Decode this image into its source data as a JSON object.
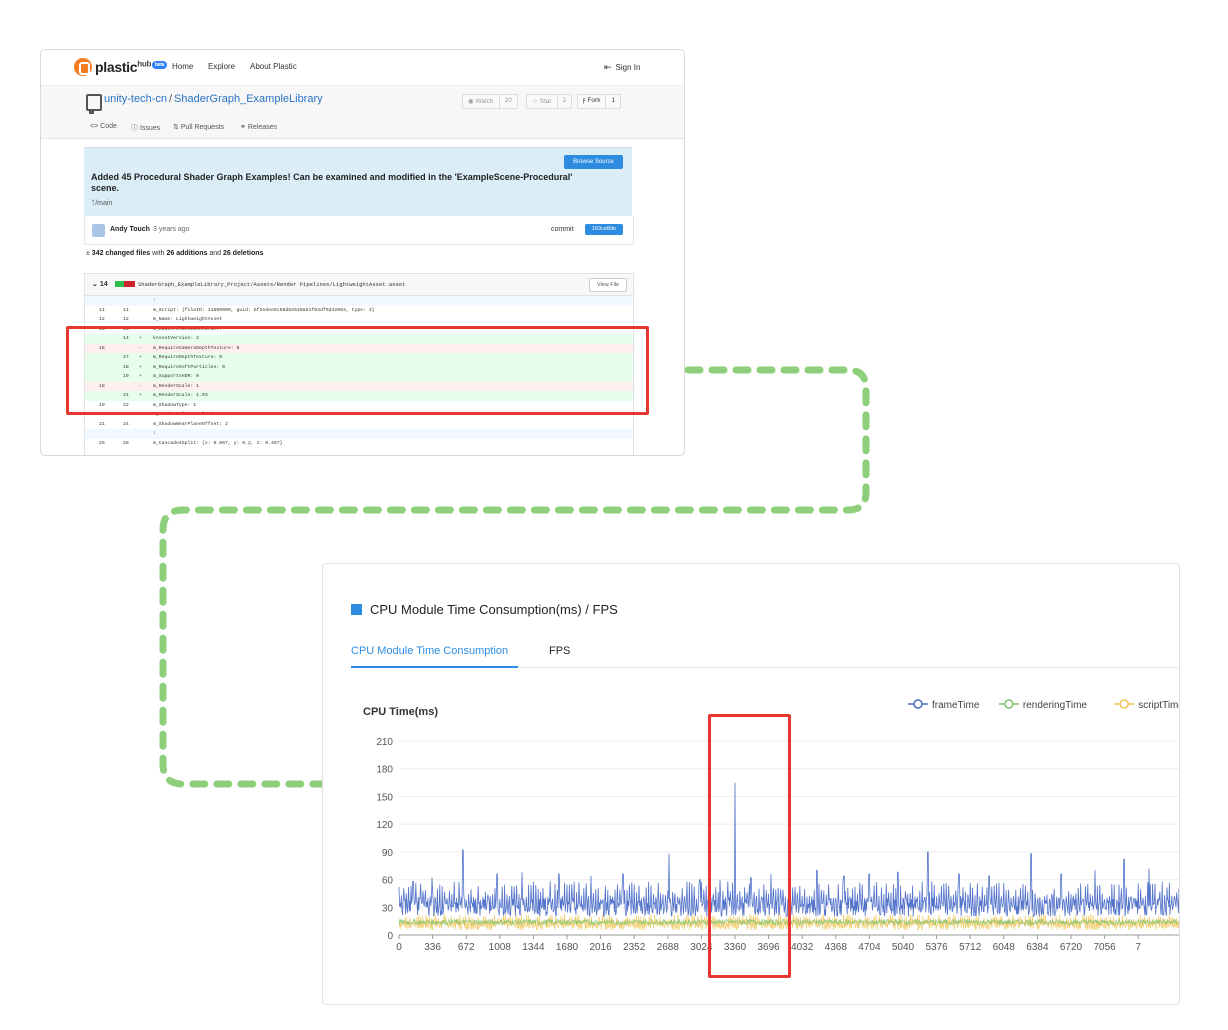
{
  "repo_page": {
    "brand": {
      "name": "plastic",
      "suffix": "hub",
      "badge": "beta"
    },
    "nav": [
      "Home",
      "Explore",
      "About Plastic"
    ],
    "sign_in": "Sign In",
    "repo_owner": "unity-tech-cn",
    "repo_name": "ShaderGraph_ExampleLibrary",
    "watch": {
      "label": "Watch",
      "count": "20"
    },
    "star": {
      "label": "Star",
      "count": "2"
    },
    "fork": {
      "label": "Fork",
      "count": "1"
    },
    "tabs": [
      "Code",
      "Issues",
      "Pull Requests",
      "Releases"
    ],
    "browse_source": "Browse Source",
    "commit_message": "Added 45 Procedural Shader Graph Examples! Can be examined and modified in the 'ExampleScene-Procedural' scene.",
    "branch": "/main",
    "author": "Andy Touch",
    "time_ago": "3 years ago",
    "commit_label": "commit",
    "commit_hash": "163ce8de",
    "changed_files": "342 changed files",
    "with_text": "with",
    "additions": "26 additions",
    "and_text": "and",
    "deletions": "26 deletions",
    "file_change_count": "14",
    "file_path": "ShaderGraph_ExampleLibrary_Project/Assets/Render Pipelines/LightweightAsset.asset",
    "view_file": "View File",
    "diff_lines": [
      {
        "type": "hunk",
        "n1": "",
        "n2": "",
        "sign": "",
        "text": "↑"
      },
      {
        "type": "ctx",
        "n1": "11",
        "n2": "11",
        "sign": "",
        "text": "m_Script: {fileID: 11500000, guid: bf2edee5c58d82540a51f03df9d42094, type: 3}"
      },
      {
        "type": "ctx",
        "n1": "12",
        "n2": "12",
        "sign": "",
        "text": "m_Name: LightweightAsset"
      },
      {
        "type": "ctx",
        "n1": "13",
        "n2": "13",
        "sign": "",
        "text": "m_EditorClassIdentifier:"
      },
      {
        "type": "add",
        "n1": "",
        "n2": "14",
        "sign": "+",
        "text": "kAssetVersion: 2"
      },
      {
        "type": "del",
        "n1": "16",
        "n2": "",
        "sign": "-",
        "text": "m_RequireCameraDepthTexture: 0"
      },
      {
        "type": "add",
        "n1": "",
        "n2": "17",
        "sign": "+",
        "text": "m_RequireDepthTexture: 0"
      },
      {
        "type": "add",
        "n1": "",
        "n2": "18",
        "sign": "+",
        "text": "m_RequireSoftParticles: 0"
      },
      {
        "type": "add",
        "n1": "",
        "n2": "19",
        "sign": "+",
        "text": "m_SupportsHDR: 0"
      },
      {
        "type": "del",
        "n1": "18",
        "n2": "",
        "sign": "-",
        "text": "m_RenderScale: 1"
      },
      {
        "type": "add",
        "n1": "",
        "n2": "21",
        "sign": "+",
        "text": "m_RenderScale: 1.03"
      },
      {
        "type": "ctx",
        "n1": "19",
        "n2": "22",
        "sign": "",
        "text": "m_ShadowType: 1"
      },
      {
        "type": "ctx",
        "n1": "20",
        "n2": "23",
        "sign": "",
        "text": "m_ShadowAtlasResolution: 1024"
      },
      {
        "type": "ctx",
        "n1": "21",
        "n2": "24",
        "sign": "",
        "text": "m_ShadowNearPlaneOffset: 2"
      },
      {
        "type": "hunk",
        "n1": "",
        "n2": "",
        "sign": "",
        "text": "↕"
      },
      {
        "type": "ctx",
        "n1": "25",
        "n2": "28",
        "sign": "",
        "text": "m_Cascade4Split: {x: 0.067, y: 0.2, z: 0.467}"
      }
    ]
  },
  "chart_panel": {
    "title": "CPU Module Time Consumption(ms) / FPS",
    "tabs": {
      "active": "CPU Module Time Consumption",
      "inactive": "FPS"
    },
    "accent": "#2d8ce0"
  },
  "chart_data": {
    "type": "line",
    "ylabel": "CPU Time(ms)",
    "xlabel": "",
    "ylim": [
      0,
      210
    ],
    "yticks": [
      0,
      30,
      60,
      90,
      120,
      150,
      180,
      210
    ],
    "xticks": [
      "0",
      "336",
      "672",
      "1008",
      "1344",
      "1680",
      "2016",
      "2352",
      "2688",
      "3024",
      "3360",
      "3696",
      "4032",
      "4368",
      "4704",
      "5040",
      "5376",
      "5712",
      "6048",
      "6384",
      "6720",
      "7056",
      "7"
    ],
    "series": [
      {
        "name": "frameTime",
        "color": "#4a6bc8",
        "baseline_ms": 30,
        "spikes": [
          {
            "x": 140,
            "y": 58
          },
          {
            "x": 330,
            "y": 62
          },
          {
            "x": 640,
            "y": 92
          },
          {
            "x": 980,
            "y": 66
          },
          {
            "x": 1230,
            "y": 68
          },
          {
            "x": 1600,
            "y": 66
          },
          {
            "x": 1920,
            "y": 64
          },
          {
            "x": 2240,
            "y": 66
          },
          {
            "x": 2700,
            "y": 88
          },
          {
            "x": 3010,
            "y": 60
          },
          {
            "x": 3210,
            "y": 60
          },
          {
            "x": 3360,
            "y": 165
          },
          {
            "x": 3520,
            "y": 62
          },
          {
            "x": 3720,
            "y": 66
          },
          {
            "x": 3900,
            "y": 72
          },
          {
            "x": 4180,
            "y": 70
          },
          {
            "x": 4450,
            "y": 64
          },
          {
            "x": 4700,
            "y": 66
          },
          {
            "x": 4990,
            "y": 68
          },
          {
            "x": 5290,
            "y": 90
          },
          {
            "x": 5600,
            "y": 66
          },
          {
            "x": 5900,
            "y": 64
          },
          {
            "x": 6320,
            "y": 88
          },
          {
            "x": 6620,
            "y": 66
          },
          {
            "x": 6960,
            "y": 70
          },
          {
            "x": 7250,
            "y": 82
          },
          {
            "x": 7500,
            "y": 72
          }
        ]
      },
      {
        "name": "renderingTime",
        "color": "#7cc26a",
        "baseline_ms": 14
      },
      {
        "name": "scriptTime",
        "color": "#f1c350",
        "baseline_ms": 10
      },
      {
        "name": "",
        "color": "#e5372f",
        "baseline_ms": 0
      }
    ],
    "legend_position": "top-right",
    "grid": true
  }
}
